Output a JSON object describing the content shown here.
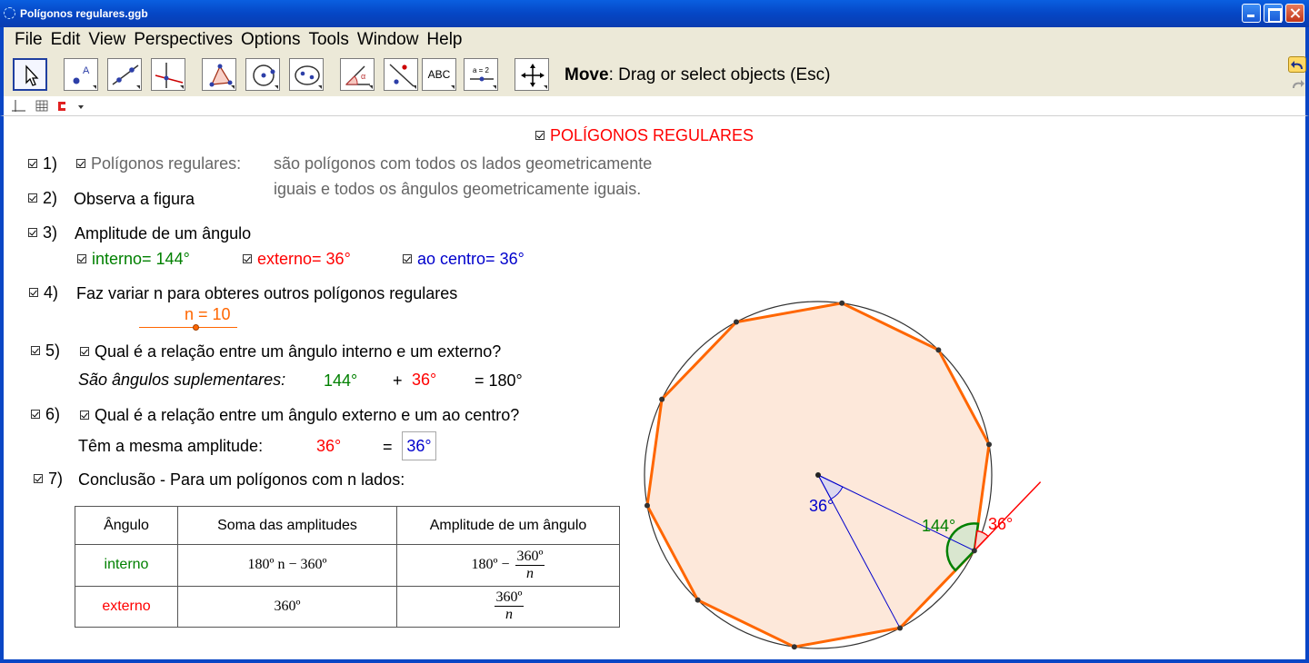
{
  "window": {
    "title": "Polígonos regulares.ggb"
  },
  "menu": [
    "File",
    "Edit",
    "View",
    "Perspectives",
    "Options",
    "Tools",
    "Window",
    "Help"
  ],
  "toolbar": {
    "hint_bold": "Move",
    "hint_rest": ": Drag or select objects (Esc)",
    "text_tool_label": "ABC",
    "slider_tool_label": "a = 2"
  },
  "canvas": {
    "heading": "POLÍGONOS REGULARES",
    "item1": {
      "num": "1)",
      "label": "Polígonos regulares:",
      "def_line1": "são polígonos com todos os lados geometricamente",
      "def_line2": "iguais e todos os ângulos geometricamente iguais."
    },
    "item2": {
      "num": "2)",
      "label": "Observa a figura"
    },
    "item3": {
      "num": "3)",
      "label": "Amplitude de um ângulo",
      "interno": "interno= 144°",
      "externo": "externo= 36°",
      "centro": "ao centro= 36°"
    },
    "item4": {
      "num": "4)",
      "label": "Faz variar n para obteres outros polígonos regulares",
      "slider_label": "n = 10",
      "n": 10
    },
    "item5": {
      "num": "5)",
      "question": "Qual é a relação entre um ângulo interno e um externo?",
      "answer_label": "São ângulos suplementares:",
      "a": "144°",
      "plus": "+",
      "b": "36°",
      "eq": "= 180°"
    },
    "item6": {
      "num": "6)",
      "question": "Qual é a relação entre um ângulo externo e um ao centro?",
      "answer_label": "Têm a mesma amplitude:",
      "a": "36°",
      "eq": "=",
      "b": "36°"
    },
    "item7": {
      "num": "7)",
      "label": "Conclusão - Para um polígonos com n lados:"
    },
    "table": {
      "headers": [
        "Ângulo",
        "Soma das amplitudes",
        "Amplitude de um ângulo"
      ],
      "row_interno": {
        "name": "interno",
        "sum": "180º n − 360º",
        "amp_prefix": "180º −",
        "amp_num": "360º",
        "amp_den": "n"
      },
      "row_externo": {
        "name": "externo",
        "sum": "360º",
        "amp_num": "360º",
        "amp_den": "n"
      }
    },
    "figure": {
      "label_center": "36°",
      "label_interior": "144°",
      "label_exterior": "36°",
      "polygon_color": "#ff6600",
      "fill_color": "#fde8da"
    }
  }
}
